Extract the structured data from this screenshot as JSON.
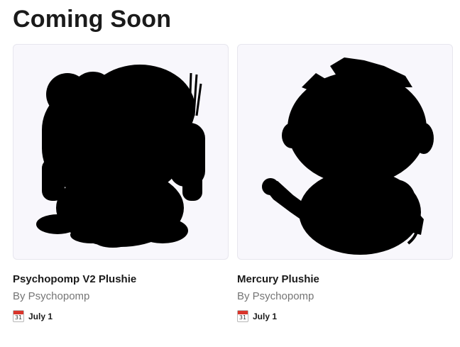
{
  "section": {
    "title": "Coming Soon"
  },
  "items": [
    {
      "name": "Psychopomp V2 Plushie",
      "author": "By Psychopomp",
      "date": "July 1",
      "calendar_icon_day": "31",
      "image_icon": "plushie-silhouette-icon"
    },
    {
      "name": "Mercury Plushie",
      "author": "By Psychopomp",
      "date": "July 1",
      "calendar_icon_day": "31",
      "image_icon": "plushie-silhouette-icon"
    }
  ],
  "colors": {
    "thumbnail_bg": "#f8f7fc",
    "silhouette": "#000000",
    "author_text": "#757575",
    "calendar_red": "#d9352b"
  }
}
